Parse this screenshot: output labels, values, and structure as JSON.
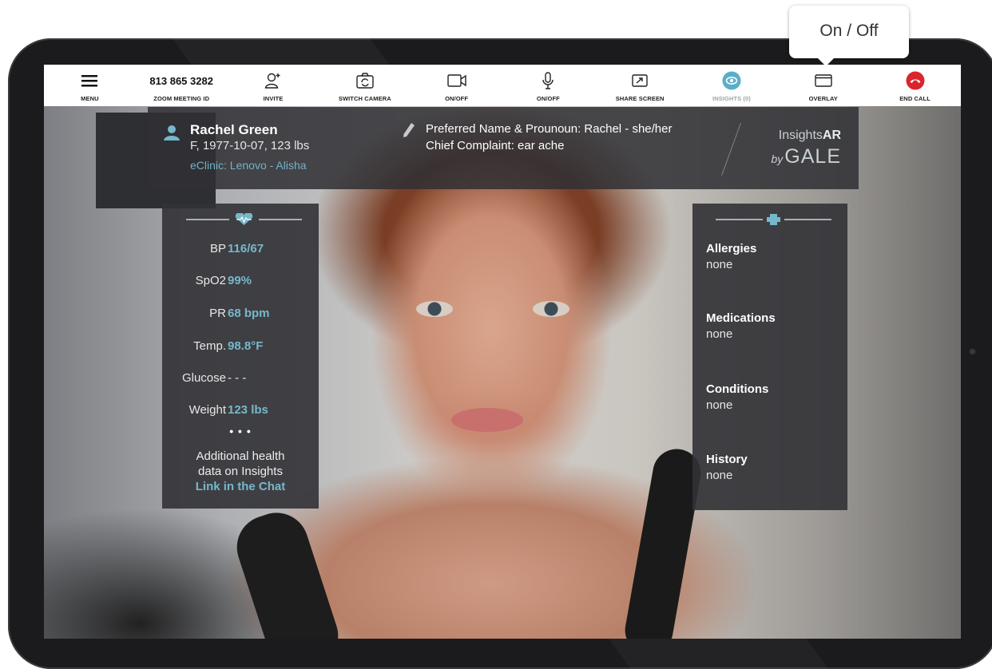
{
  "toolbar": {
    "menu": {
      "label": "MENU",
      "icon": "hamburger-icon"
    },
    "meeting": {
      "value": "813 865 3282",
      "label": "ZOOM MEETING ID"
    },
    "invite": {
      "label": "INVITE",
      "icon": "add-person-icon"
    },
    "switch_camera": {
      "label": "SWITCH CAMERA",
      "icon": "camera-switch-icon"
    },
    "video": {
      "label": "ON/OFF",
      "icon": "video-camera-icon"
    },
    "mic": {
      "label": "ON/OFF",
      "icon": "microphone-icon"
    },
    "share": {
      "label": "SHARE SCREEN",
      "icon": "share-screen-icon"
    },
    "insights": {
      "label": "INSIGHTS (0)",
      "icon": "eye-icon",
      "color": "#5aaec8"
    },
    "overlay": {
      "label": "OVERLAY",
      "icon": "window-icon"
    },
    "end_call": {
      "label": "END CALL",
      "icon": "hang-up-icon",
      "color": "#d9262c"
    }
  },
  "tooltip": {
    "text": "On / Off"
  },
  "patient": {
    "name": "Rachel Green",
    "demographics": "F, 1977-10-07, 123 lbs",
    "clinic": "eClinic: Lenovo - Alisha",
    "preferred": "Preferred Name & Prounoun: Rachel - she/her",
    "complaint": "Chief Complaint: ear ache"
  },
  "brand": {
    "line1": "Insights",
    "line1_bold": "AR",
    "by": "by",
    "line2": "GALE"
  },
  "vitals": [
    {
      "key": "BP",
      "value": "116/67"
    },
    {
      "key": "SpO2",
      "value": "99%"
    },
    {
      "key": "PR",
      "value": "68 bpm"
    },
    {
      "key": "Temp.",
      "value": "98.8°F"
    },
    {
      "key": "Glucose",
      "value": "- - -"
    },
    {
      "key": "Weight",
      "value": "123 lbs"
    }
  ],
  "vitals_more": {
    "dots": "• • •",
    "line1": "Additional health",
    "line2": "data on Insights",
    "link": "Link in the Chat"
  },
  "history": [
    {
      "key": "Allergies",
      "value": "none"
    },
    {
      "key": "Medications",
      "value": "none"
    },
    {
      "key": "Conditions",
      "value": "none"
    },
    {
      "key": "History",
      "value": "none"
    }
  ],
  "colors": {
    "accent": "#76b8cb",
    "panel": "#323236"
  }
}
